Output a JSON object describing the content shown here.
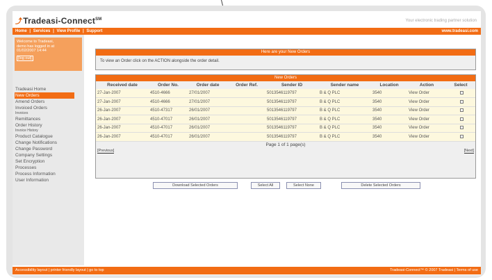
{
  "brand": {
    "name": "Tradeasi-Connect",
    "tm": "SM",
    "tagline": "Your electronic trading partner solution"
  },
  "topbar": {
    "nav": [
      "Home",
      "Services",
      "View Profile",
      "Support"
    ],
    "separator": "|",
    "site_url": "www.tradeasi.com"
  },
  "welcome": {
    "line1": "Welcome to Tradeasi,",
    "line2": "demo has logged in at",
    "line3": "01/02/2007 14:44",
    "logout": "[log out]"
  },
  "sidebar": {
    "items": [
      {
        "label": "Tradeasi Home",
        "small": false,
        "active": false
      },
      {
        "label": "New Orders",
        "small": false,
        "active": true
      },
      {
        "label": "Amend Orders",
        "small": false,
        "active": false
      },
      {
        "label": "Invoiced Orders",
        "small": false,
        "active": false
      },
      {
        "label": "Invoices",
        "small": true,
        "active": false
      },
      {
        "label": "Remittances",
        "small": false,
        "active": false
      },
      {
        "label": "Order History",
        "small": false,
        "active": false
      },
      {
        "label": "Invoice History",
        "small": true,
        "active": false
      },
      {
        "label": "Product Catalogue",
        "small": false,
        "active": false
      },
      {
        "label": "Change Notifications",
        "small": false,
        "active": false
      },
      {
        "label": "Change Password",
        "small": false,
        "active": false
      },
      {
        "label": "Company Settings",
        "small": false,
        "active": false
      },
      {
        "label": "Set Encryption",
        "small": false,
        "active": false
      },
      {
        "label": "Processes",
        "small": false,
        "active": false
      },
      {
        "label": "Process Information",
        "small": false,
        "active": false
      },
      {
        "label": "User Information",
        "small": false,
        "active": false
      }
    ]
  },
  "info_panel": {
    "title": "Here are your New Orders",
    "text": "To view an Order click on the ACTION alongside the order detail."
  },
  "orders_panel": {
    "title": "New Orders",
    "columns": [
      "Received date",
      "Order No.",
      "Order date",
      "Order Ref.",
      "Sender ID",
      "Sender name",
      "Location",
      "Action",
      "Select"
    ],
    "rows": [
      [
        "27-Jan-2007",
        "4510-4666",
        "27/01/2007",
        "",
        "5013546119797",
        "B & Q PLC",
        "3540",
        "View Order"
      ],
      [
        "27-Jan-2007",
        "4510-4666",
        "27/01/2007",
        "",
        "5013546119797",
        "B & Q PLC",
        "3540",
        "View Order"
      ],
      [
        "26-Jan-2007",
        "4510-47317",
        "26/01/2007",
        "",
        "5013546119797",
        "B & Q PLC",
        "3540",
        "View Order"
      ],
      [
        "26-Jan-2007",
        "4510-47017",
        "26/01/2007",
        "",
        "5013546119797",
        "B & Q PLC",
        "3540",
        "View Order"
      ],
      [
        "26-Jan-2007",
        "4510-47017",
        "26/01/2007",
        "",
        "5013546119797",
        "B & Q PLC",
        "3540",
        "View Order"
      ],
      [
        "26-Jan-2007",
        "4510-47017",
        "26/01/2007",
        "",
        "5013546119797",
        "B & Q PLC",
        "3540",
        "View Order"
      ]
    ],
    "pager": "Page 1 of 1 page(s)",
    "previous": "[Previous]",
    "next": "[Next]"
  },
  "buttons": {
    "download": "Download Selected Orders",
    "select_all": "Select All",
    "select_none": "Select None",
    "delete": "Delete Selected Orders"
  },
  "footer": {
    "left": "Accessibility layout | printer friendly layout | go to top",
    "right": "Tradeasi-Connect™ © 2007 Tradeasi | Terms of use"
  },
  "colors": {
    "accent": "#f26c14",
    "row_bg": "#fdf8de",
    "panel_bg": "#efefef"
  }
}
